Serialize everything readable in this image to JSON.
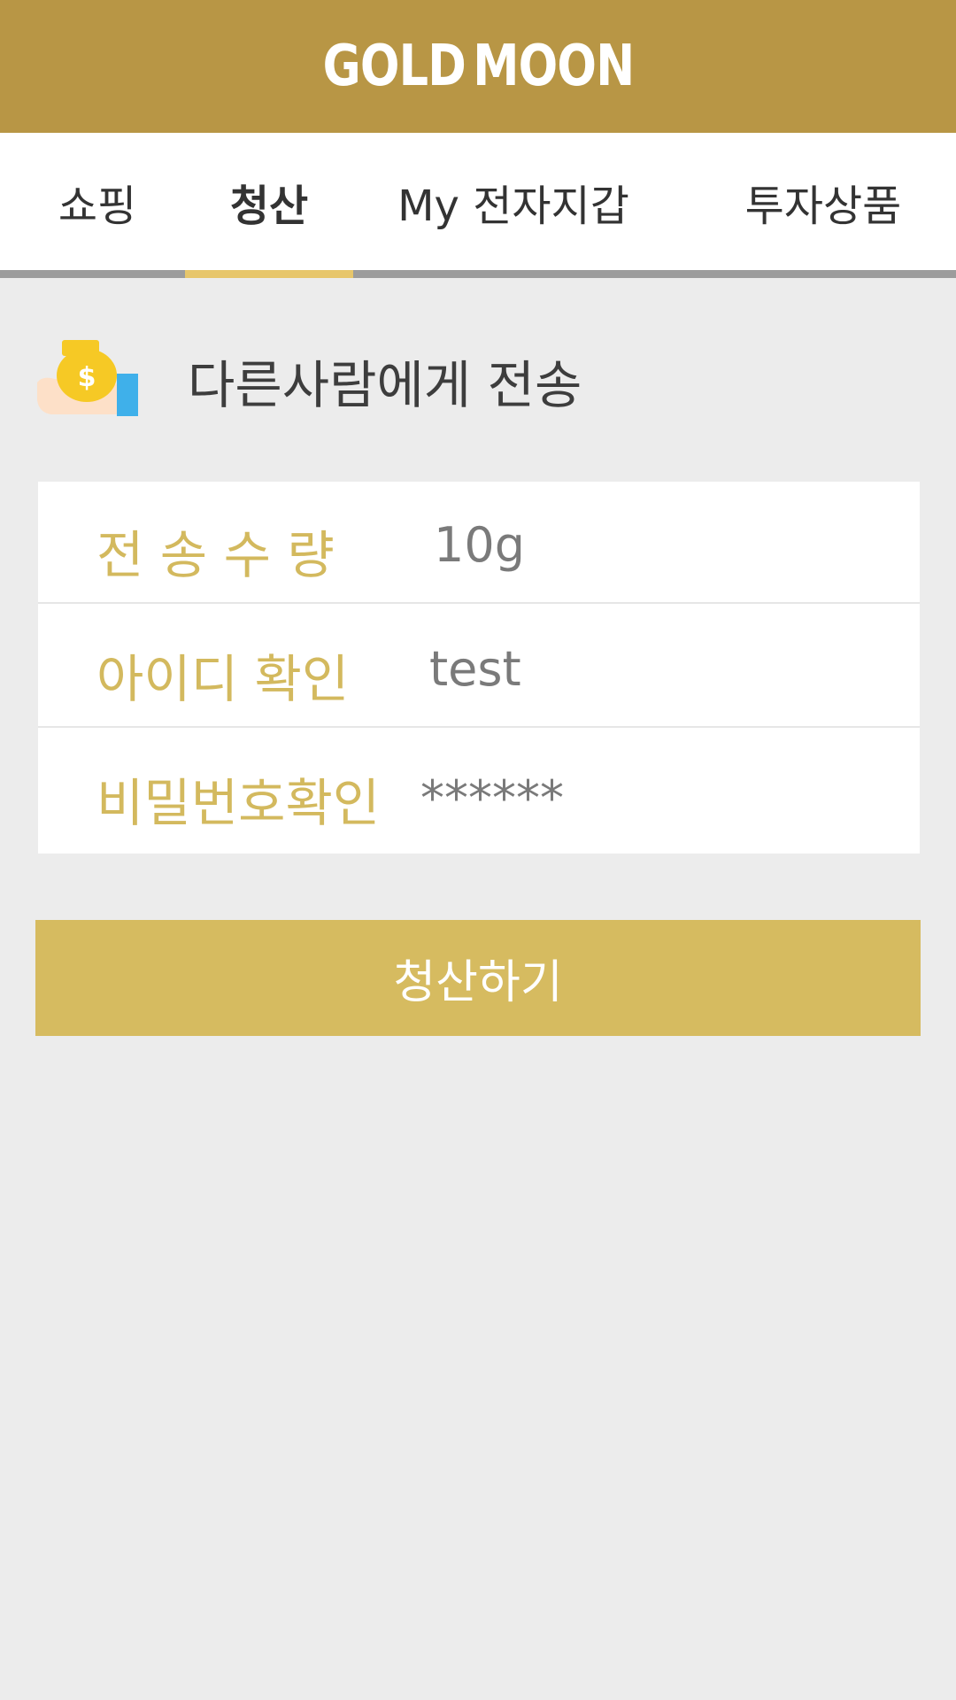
{
  "header": {
    "brand_left": "GOLD",
    "brand_right": "MOON"
  },
  "tabs": [
    {
      "label": "쇼핑",
      "active": false
    },
    {
      "label": "청산",
      "active": true
    },
    {
      "label": "My 전자지갑",
      "active": false
    },
    {
      "label": "투자상품",
      "active": false
    }
  ],
  "section": {
    "title": "다른사람에게 전송",
    "icon": "money-bag-hand-icon"
  },
  "form": {
    "rows": [
      {
        "label": "전 송 수 량",
        "value": "10g"
      },
      {
        "label": "아이디 확인",
        "value": "test"
      },
      {
        "label": "비밀번호확인",
        "value": "******"
      }
    ]
  },
  "submit": {
    "label": "청산하기"
  },
  "colors": {
    "header": "#b89645",
    "accent": "#d6bb60",
    "label": "#d3b95e",
    "tab_indicator": "#e7c66b"
  }
}
